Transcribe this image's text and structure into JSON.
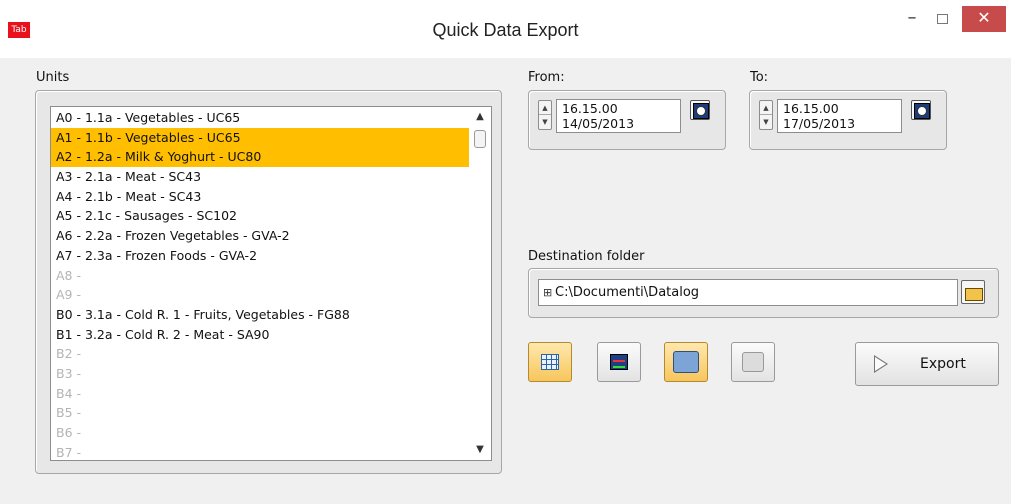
{
  "window": {
    "app_icon_text": "Tab",
    "title": "Quick Data Export",
    "minimize_label": "–",
    "close_label": "✕"
  },
  "units": {
    "label": "Units",
    "items": [
      {
        "text": "A0 - 1.1a - Vegetables - UC65",
        "state": "normal"
      },
      {
        "text": "A1 - 1.1b - Vegetables - UC65",
        "state": "selected"
      },
      {
        "text": "A2 - 1.2a - Milk & Yoghurt - UC80",
        "state": "selected"
      },
      {
        "text": "A3 - 2.1a - Meat - SC43",
        "state": "normal"
      },
      {
        "text": "A4 - 2.1b - Meat - SC43",
        "state": "normal"
      },
      {
        "text": "A5 - 2.1c - Sausages - SC102",
        "state": "normal"
      },
      {
        "text": "A6 - 2.2a - Frozen Vegetables - GVA-2",
        "state": "normal"
      },
      {
        "text": "A7 - 2.3a - Frozen Foods - GVA-2",
        "state": "normal"
      },
      {
        "text": "A8 -",
        "state": "disabled"
      },
      {
        "text": "A9 -",
        "state": "disabled"
      },
      {
        "text": "B0 - 3.1a - Cold R. 1 - Fruits, Vegetables - FG88",
        "state": "normal"
      },
      {
        "text": "B1 - 3.2a - Cold R. 2 - Meat - SA90",
        "state": "normal"
      },
      {
        "text": "B2 -",
        "state": "disabled"
      },
      {
        "text": "B3 -",
        "state": "disabled"
      },
      {
        "text": "B4 -",
        "state": "disabled"
      },
      {
        "text": "B5 -",
        "state": "disabled"
      },
      {
        "text": "B6 -",
        "state": "disabled"
      },
      {
        "text": "B7 -",
        "state": "disabled"
      }
    ]
  },
  "from": {
    "label": "From:",
    "time": "16.15.00",
    "date": "14/05/2013"
  },
  "to": {
    "label": "To:",
    "time": "16.15.00",
    "date": "17/05/2013"
  },
  "destination": {
    "label": "Destination folder",
    "path": "C:\\Documenti\\Datalog"
  },
  "toolbar": {
    "buttons": [
      {
        "icon": "table-icon",
        "active": true
      },
      {
        "icon": "chart-icon",
        "active": false
      },
      {
        "icon": "save-icon",
        "active": true
      },
      {
        "icon": "print-icon",
        "active": false
      }
    ],
    "export_label": "Export"
  },
  "colors": {
    "selection": "#ffbe00",
    "close_button": "#c74b4b",
    "disabled_text": "#b4b4b4"
  }
}
